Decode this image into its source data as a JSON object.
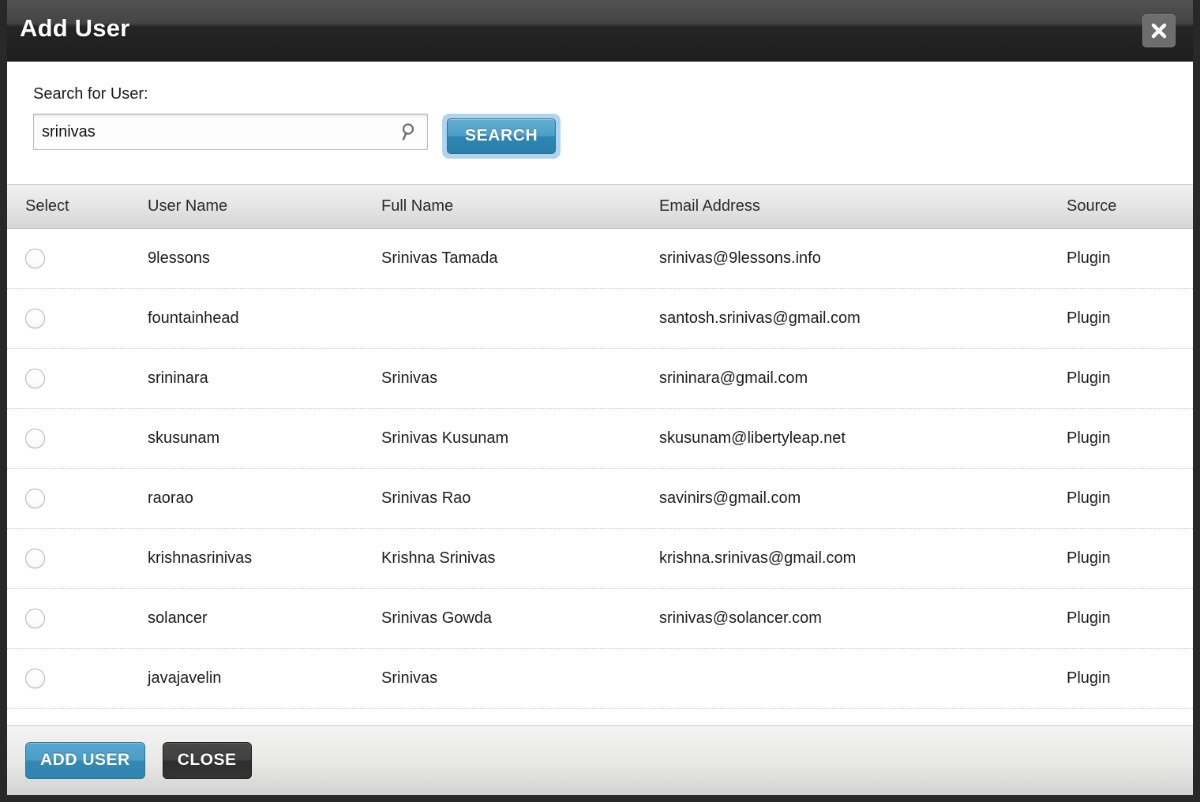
{
  "dialog": {
    "title": "Add User",
    "close_icon": "close-icon"
  },
  "search": {
    "label": "Search for User:",
    "value": "srinivas",
    "placeholder": "",
    "magnifier_icon": "search-icon",
    "button_label": "SEARCH"
  },
  "table": {
    "columns": [
      "Select",
      "User Name",
      "Full Name",
      "Email Address",
      "Source"
    ],
    "rows": [
      {
        "user_name": "9lessons",
        "full_name": "Srinivas Tamada",
        "email": "srinivas@9lessons.info",
        "source": "Plugin",
        "selected": false
      },
      {
        "user_name": "fountainhead",
        "full_name": "",
        "email": "santosh.srinivas@gmail.com",
        "source": "Plugin",
        "selected": false
      },
      {
        "user_name": "srininara",
        "full_name": "Srinivas",
        "email": "srininara@gmail.com",
        "source": "Plugin",
        "selected": false
      },
      {
        "user_name": "skusunam",
        "full_name": "Srinivas Kusunam",
        "email": "skusunam@libertyleap.net",
        "source": "Plugin",
        "selected": false
      },
      {
        "user_name": "raorao",
        "full_name": "Srinivas Rao",
        "email": "savinirs@gmail.com",
        "source": "Plugin",
        "selected": false
      },
      {
        "user_name": "krishnasrinivas",
        "full_name": "Krishna Srinivas",
        "email": "krishna.srinivas@gmail.com",
        "source": "Plugin",
        "selected": false
      },
      {
        "user_name": "solancer",
        "full_name": "Srinivas Gowda",
        "email": "srinivas@solancer.com",
        "source": "Plugin",
        "selected": false
      },
      {
        "user_name": "javajavelin",
        "full_name": "Srinivas",
        "email": "",
        "source": "Plugin",
        "selected": false
      }
    ]
  },
  "footer": {
    "add_user_label": "ADD USER",
    "close_label": "CLOSE"
  },
  "colors": {
    "accent_blue": "#3289b4",
    "titlebar_dark": "#1e1e1e",
    "focus_ring": "#aed4ef",
    "footer_gray": "#e8e8e6"
  }
}
